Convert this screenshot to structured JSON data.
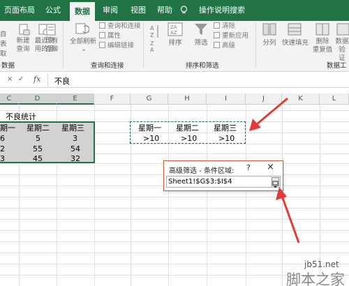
{
  "ribbon_tabs": [
    "页面布局",
    "公式",
    "数据",
    "审阅",
    "视图",
    "帮助",
    "操作说明搜索"
  ],
  "ribbon": {
    "left_buttons": [
      "新建\n查询",
      "最近使\n用的源",
      "现有\n连接"
    ],
    "left_fragment": [
      "自",
      "表",
      "取"
    ],
    "refresh_label": "全部刷新",
    "queries_items": [
      "查询和连接",
      "属性",
      "编辑链接"
    ],
    "queries_group": "查询和连接",
    "sort_label": "排序",
    "filter_label": "筛选",
    "filter_items": [
      "清除",
      "重新应用",
      "高级"
    ],
    "sort_group": "排序和筛选",
    "split_label": "分列",
    "flashfill_label": "快速填充",
    "dedupe_label": "删除\n重复值",
    "validate_label": "数据验\n证",
    "tools_group": "数据工",
    "data_group_fragment": "数据"
  },
  "formula_bar": {
    "cancel": "×",
    "enter": "✓",
    "fx": "fx",
    "value": "不良"
  },
  "columns": [
    "C",
    "D",
    "E",
    "F",
    "G",
    "H",
    "I",
    "J",
    "K",
    "L"
  ],
  "sheet": {
    "title": "不良统计",
    "headers": [
      "期一",
      "星期二",
      "星期三"
    ],
    "rows": [
      [
        "6",
        "5",
        "3"
      ],
      [
        "2",
        "55",
        "54"
      ],
      [
        "3",
        "45",
        "32"
      ]
    ],
    "criteria_headers": [
      "星期一",
      "星期二",
      "星期三"
    ],
    "criteria_values": [
      ">10",
      ">10",
      ">10"
    ]
  },
  "dialog": {
    "title": "高级筛选 - 条件区域:",
    "help": "?",
    "close": "×",
    "value": "Sheet1!$G$3:$I$4"
  },
  "watermark": {
    "line1": "jb51.net",
    "line2": "脚本之家"
  },
  "colors": {
    "accent": "#217346",
    "arrow": "#e53935"
  }
}
